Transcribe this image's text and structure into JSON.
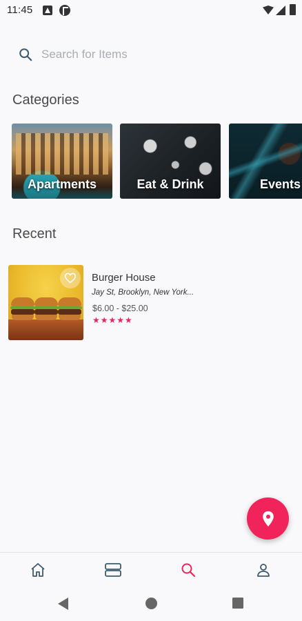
{
  "status_bar": {
    "time": "11:45"
  },
  "search": {
    "placeholder": "Search for Items"
  },
  "categories": {
    "title": "Categories",
    "items": [
      {
        "label": "Apartments"
      },
      {
        "label": "Eat & Drink"
      },
      {
        "label": "Events"
      }
    ]
  },
  "recent": {
    "title": "Recent",
    "items": [
      {
        "name": "Burger House",
        "address": "Jay St, Brooklyn, New York...",
        "price": "$6.00 - $25.00",
        "rating_stars": "★★★★★",
        "rating": 5
      }
    ]
  },
  "bottom_nav": {
    "items": [
      {
        "icon": "home-icon"
      },
      {
        "icon": "list-icon"
      },
      {
        "icon": "search-icon",
        "active": true
      },
      {
        "icon": "profile-icon"
      }
    ]
  },
  "colors": {
    "accent": "#f0245a",
    "nav_icon": "#3d5a6c",
    "background": "#f9f9fb"
  }
}
